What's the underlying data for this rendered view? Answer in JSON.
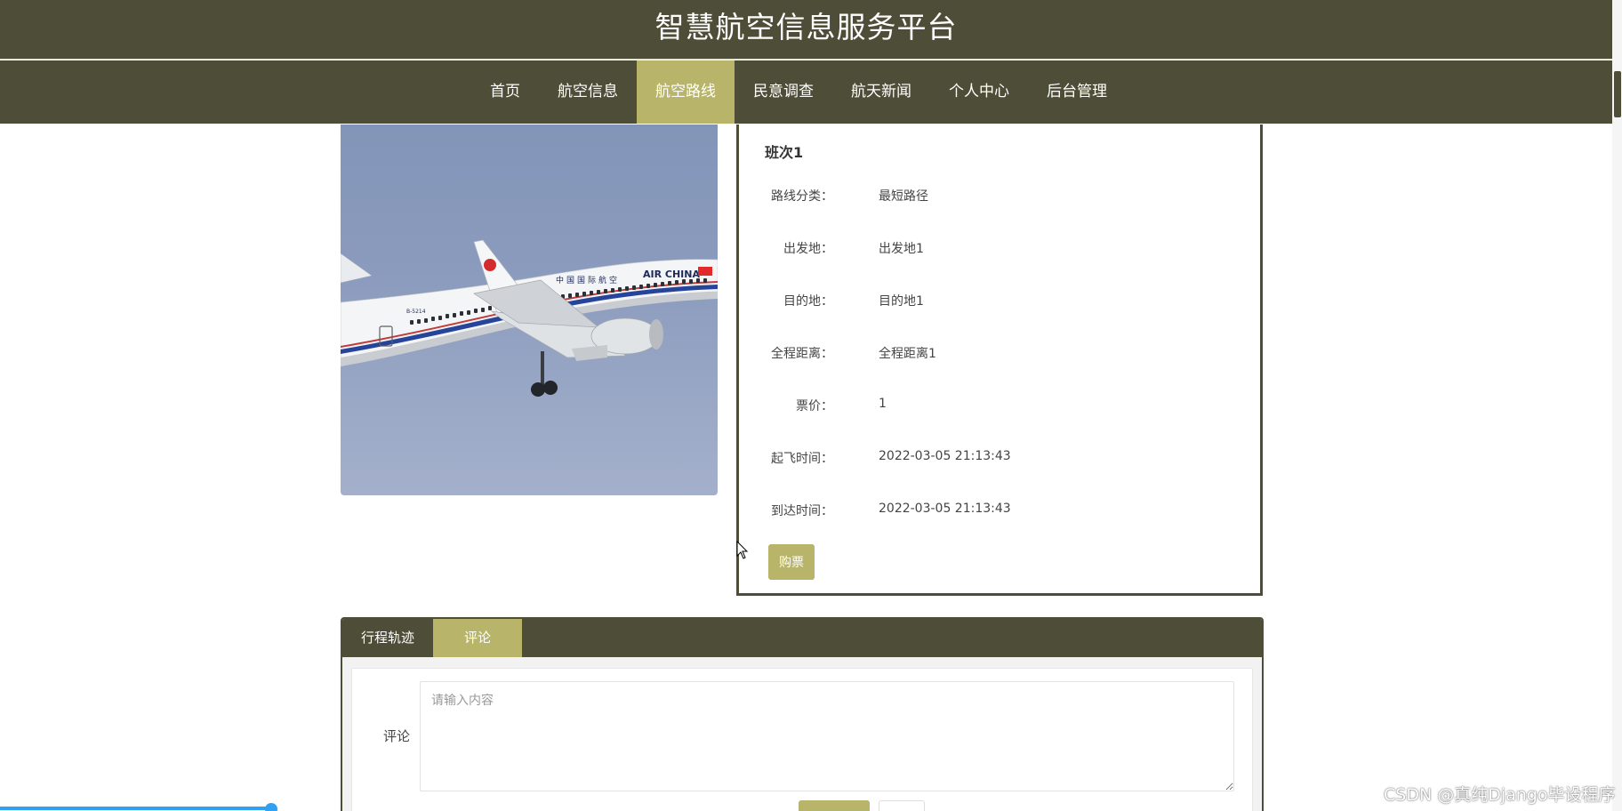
{
  "header": {
    "title": "智慧航空信息服务平台"
  },
  "nav": {
    "items": [
      {
        "label": "首页",
        "active": false
      },
      {
        "label": "航空信息",
        "active": false
      },
      {
        "label": "航空路线",
        "active": true
      },
      {
        "label": "民意调查",
        "active": false
      },
      {
        "label": "航天新闻",
        "active": false
      },
      {
        "label": "个人中心",
        "active": false
      },
      {
        "label": "后台管理",
        "active": false
      }
    ]
  },
  "route": {
    "title": "班次1",
    "fields": [
      {
        "label": "路线分类：",
        "value": "最短路径"
      },
      {
        "label": "出发地：",
        "value": "出发地1"
      },
      {
        "label": "目的地：",
        "value": "目的地1"
      },
      {
        "label": "全程距离：",
        "value": "全程距离1"
      },
      {
        "label": "票价：",
        "value": "1"
      },
      {
        "label": "起飞时间：",
        "value": "2022-03-05 21:13:43"
      },
      {
        "label": "到达时间：",
        "value": "2022-03-05 21:13:43"
      }
    ],
    "buy_label": "购票",
    "image_text": {
      "airline": "AIR CHINA",
      "registration": "B-5214"
    }
  },
  "tabs": {
    "items": [
      {
        "label": "行程轨迹",
        "active": false
      },
      {
        "label": "评论",
        "active": true
      }
    ],
    "comment_label": "评论",
    "comment_placeholder": "请输入内容"
  },
  "watermark": "CSDN @真纯Django毕设程序",
  "colors": {
    "primary": "#4e4d37",
    "accent": "#b8b56b",
    "progress": "#2ea1f2"
  }
}
